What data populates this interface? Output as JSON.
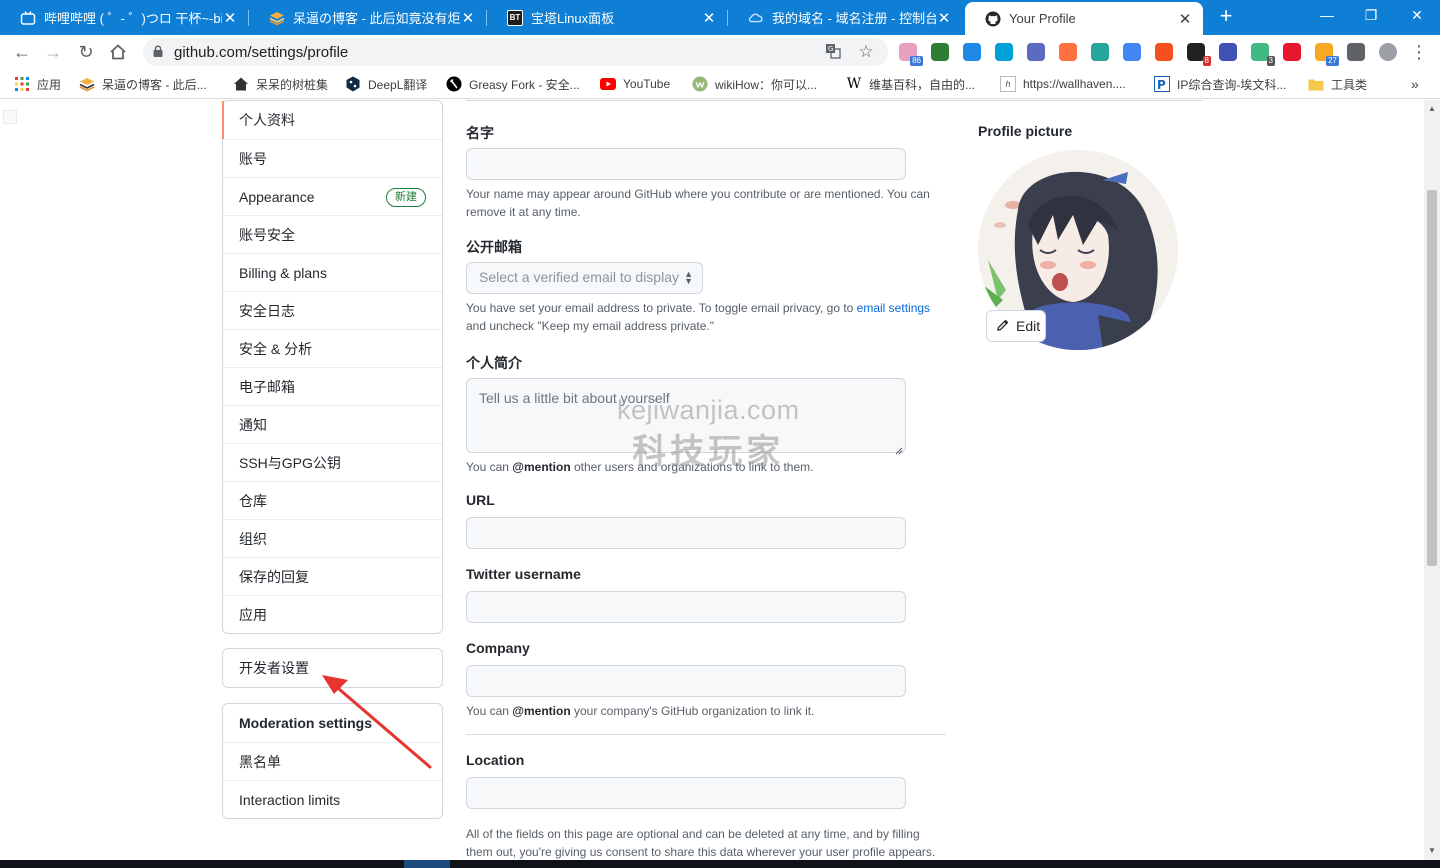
{
  "browser": {
    "tabs": [
      {
        "title": "哔哩哔哩 ( ゜- ゜)つロ 干杯~-bili",
        "active": false,
        "icon": "bilibili-icon"
      },
      {
        "title": "呆逼の博客 - 此后如竟没有炬火,",
        "active": false,
        "icon": "stack-icon"
      },
      {
        "title": "宝塔Linux面板",
        "active": false,
        "icon": "bt-icon"
      },
      {
        "title": "我的域名 - 域名注册 - 控制台",
        "active": false,
        "icon": "cloud-icon"
      },
      {
        "title": "Your Profile",
        "active": true,
        "icon": "github-icon"
      }
    ],
    "bt_label": "BT",
    "address": "github.com/settings/profile",
    "extensions": [
      {
        "name": "ext-bilibili-icon",
        "badge": "86",
        "color": "#e8a0c0"
      },
      {
        "name": "ext-globe-icon",
        "badge": "",
        "color": "#2e7d32"
      },
      {
        "name": "ext-screen-icon",
        "badge": "",
        "color": "#1e88e5"
      },
      {
        "name": "ext-tv-icon",
        "badge": "",
        "color": "#00a1d6"
      },
      {
        "name": "ext-s-icon",
        "badge": "",
        "color": "#5c6bc0"
      },
      {
        "name": "ext-firefox-icon",
        "badge": "",
        "color": "#ff7043"
      },
      {
        "name": "ext-s-green-icon",
        "badge": "",
        "color": "#26a69a"
      },
      {
        "name": "ext-translate-icon",
        "badge": "",
        "color": "#4285f4"
      },
      {
        "name": "ext-infinity-icon",
        "badge": "",
        "color": "#f4511e"
      },
      {
        "name": "ext-tampermonkey-icon",
        "badge": "8",
        "color": "#222222"
      },
      {
        "name": "ext-link-icon",
        "badge": "",
        "color": "#3f51b5"
      },
      {
        "name": "ext-vue-icon",
        "badge": "3",
        "color": "#42b883"
      },
      {
        "name": "ext-weibo-icon",
        "badge": "",
        "color": "#e6162d"
      },
      {
        "name": "ext-calendar-icon",
        "badge": "27",
        "color": "#f9a825"
      },
      {
        "name": "ext-puzzle-icon",
        "badge": "",
        "color": "#5f6368"
      },
      {
        "name": "ext-profile-icon",
        "badge": "",
        "color": "#9aa0a6"
      }
    ],
    "bookmarks": [
      {
        "label": "应用",
        "icon": "apps-grid-icon"
      },
      {
        "label": "呆逼の博客 - 此后...",
        "icon": "stack-icon"
      },
      {
        "label": "呆呆的树桩集",
        "icon": "home-icon"
      },
      {
        "label": "DeepL翻译",
        "icon": "deepl-icon"
      },
      {
        "label": "Greasy Fork - 安全...",
        "icon": "greasyfork-icon"
      },
      {
        "label": "YouTube",
        "icon": "youtube-icon"
      },
      {
        "label": "wikiHow：你可以...",
        "icon": "wikihow-icon"
      },
      {
        "label": "维基百科，自由的...",
        "icon": "wikipedia-icon"
      },
      {
        "label": "https://wallhaven....",
        "icon": "wallhaven-icon"
      },
      {
        "label": "IP综合查询-埃文科...",
        "icon": "ip-icon"
      },
      {
        "label": "工具类",
        "icon": "folder-icon"
      }
    ]
  },
  "sidebar": {
    "items": [
      {
        "label": "个人资料",
        "selected": true
      },
      {
        "label": "账号",
        "selected": false
      },
      {
        "label": "Appearance",
        "selected": false,
        "badge": "新建"
      },
      {
        "label": "账号安全",
        "selected": false
      },
      {
        "label": "Billing & plans",
        "selected": false
      },
      {
        "label": "安全日志",
        "selected": false
      },
      {
        "label": "安全 & 分析",
        "selected": false
      },
      {
        "label": "电子邮箱",
        "selected": false
      },
      {
        "label": "通知",
        "selected": false
      },
      {
        "label": "SSH与GPG公钥",
        "selected": false
      },
      {
        "label": "仓库",
        "selected": false
      },
      {
        "label": "组织",
        "selected": false
      },
      {
        "label": "保存的回复",
        "selected": false
      },
      {
        "label": "应用",
        "selected": false
      }
    ],
    "developer": "开发者设置",
    "moderation": {
      "heading": "Moderation settings",
      "items": [
        "黑名单",
        "Interaction limits"
      ]
    }
  },
  "form": {
    "name_label": "名字",
    "name_value": "",
    "name_note": "Your name may appear around GitHub where you contribute or are mentioned. You can remove it at any time.",
    "email_label": "公开邮箱",
    "email_select": "Select a verified email to display",
    "email_note_pre": "You have set your email address to private. To toggle email privacy, go to",
    "email_note_link": "email settings",
    "email_note_post": "and uncheck \"Keep my email address private.\"",
    "bio_label": "个人简介",
    "bio_placeholder": "Tell us a little bit about yourself",
    "bio_note_pre": "You can",
    "bio_note_mention": "@mention",
    "bio_note_post": "other users and organizations to link to them.",
    "url_label": "URL",
    "url_value": "",
    "twitter_label": "Twitter username",
    "twitter_value": "",
    "company_label": "Company",
    "company_value": "",
    "company_note_pre": "You can",
    "company_note_mention": "@mention",
    "company_note_post": "your company's GitHub organization to link it.",
    "location_label": "Location",
    "location_value": "",
    "footer_note": "All of the fields on this page are optional and can be deleted at any time, and by filling them out, you're giving us consent to share this data wherever your user profile appears."
  },
  "profile_picture": {
    "label": "Profile picture",
    "edit": "Edit"
  },
  "watermark": {
    "line1": "kejiwanjia.com",
    "line2": "科技玩家"
  },
  "colors": {
    "tabstrip": "#0f7fd6",
    "selected_marker": "#fd8c73",
    "arrow": "#e8332f",
    "link": "#0969da",
    "badge_green": "#1a7f37"
  }
}
